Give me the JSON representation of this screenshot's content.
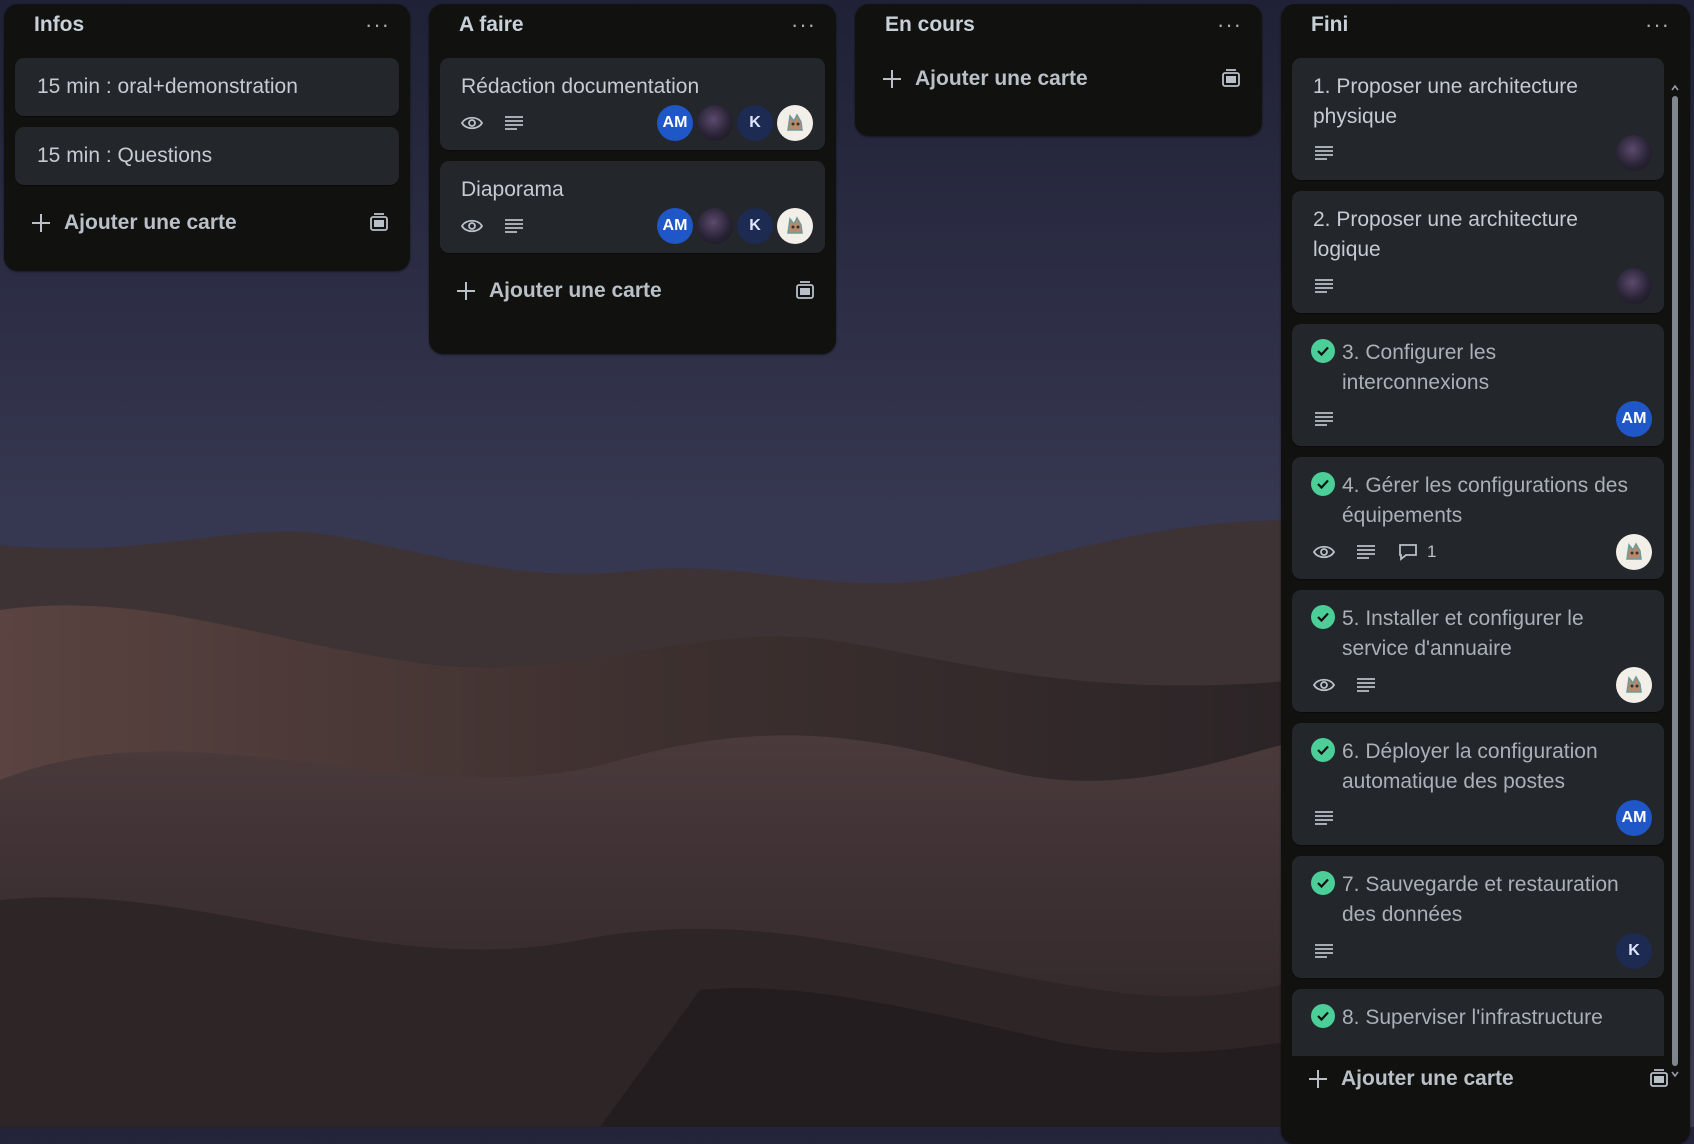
{
  "lists": {
    "infos": {
      "title": "Infos",
      "cards": [
        "15 min : oral+demonstration",
        "15 min : Questions"
      ],
      "add_label": "Ajouter une carte"
    },
    "afaire": {
      "title": "A faire",
      "cards": [
        {
          "title": "Rédaction documentation",
          "members": [
            "AM",
            "",
            "K",
            ""
          ]
        },
        {
          "title": "Diaporama",
          "members": [
            "AM",
            "",
            "K",
            ""
          ]
        }
      ],
      "add_label": "Ajouter une carte"
    },
    "encours": {
      "title": "En cours",
      "add_label": "Ajouter une carte"
    },
    "fini": {
      "title": "Fini",
      "cards": [
        {
          "title": "1. Proposer une architecture physique",
          "done": false
        },
        {
          "title": "2. Proposer une architecture logique",
          "done": false
        },
        {
          "title": "3. Configurer les interconnexions",
          "done": true,
          "member": "AM"
        },
        {
          "title": "4. Gérer les configurations des équipements",
          "done": true,
          "comments": "1"
        },
        {
          "title": "5. Installer et configurer le service d'annuaire",
          "done": true
        },
        {
          "title": "6. Déployer la configuration automatique des postes",
          "done": true,
          "member": "AM"
        },
        {
          "title": "7. Sauvegarde et restauration des données",
          "done": true,
          "member": "K"
        },
        {
          "title": "8. Superviser l'infrastructure",
          "done": true
        }
      ],
      "add_label": "Ajouter une carte"
    }
  },
  "icons": {
    "more": "more-icon",
    "add": "plus-icon",
    "template": "template-icon",
    "watch": "eye-icon",
    "description": "description-icon",
    "comment": "comment-icon",
    "complete": "check-circle-icon"
  },
  "colors": {
    "list_bg": "#111210",
    "card_bg": "#23262a",
    "avatar_am": "#1f56c8",
    "avatar_k": "#1d2a52",
    "complete_green": "#4bce97"
  }
}
